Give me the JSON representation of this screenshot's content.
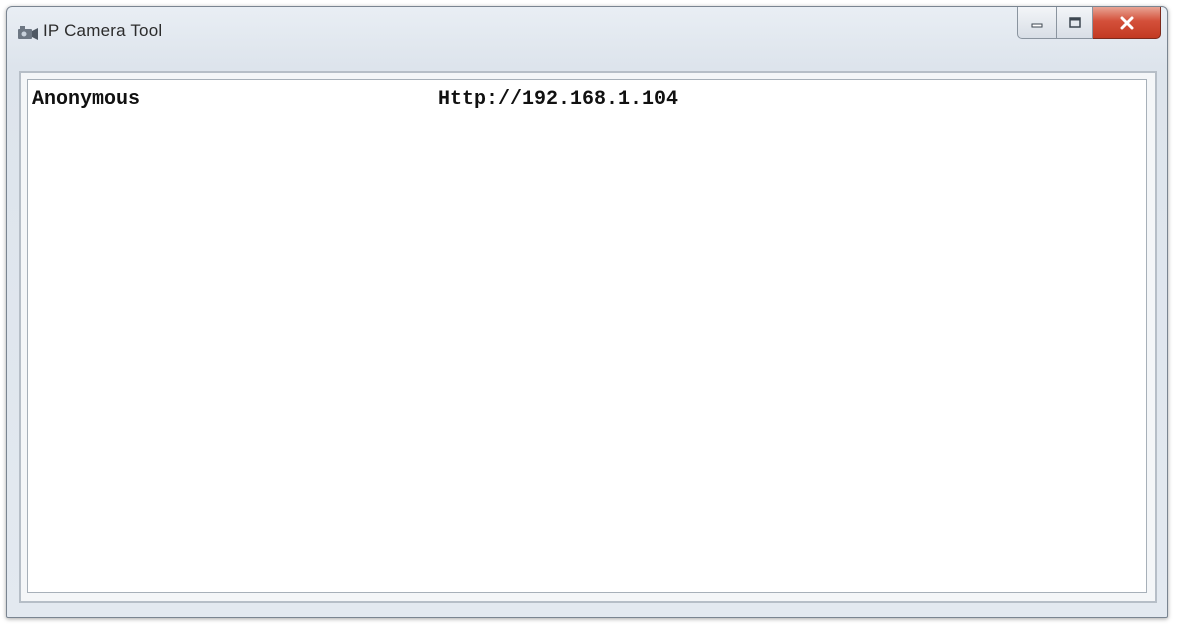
{
  "window": {
    "title": "IP Camera Tool",
    "icon": "camera-icon",
    "caption_buttons": [
      "minimize",
      "maximize",
      "close"
    ],
    "close_color": "#c8432a"
  },
  "list": {
    "rows": [
      {
        "user": "Anonymous",
        "address": "Http://192.168.1.104"
      }
    ]
  }
}
